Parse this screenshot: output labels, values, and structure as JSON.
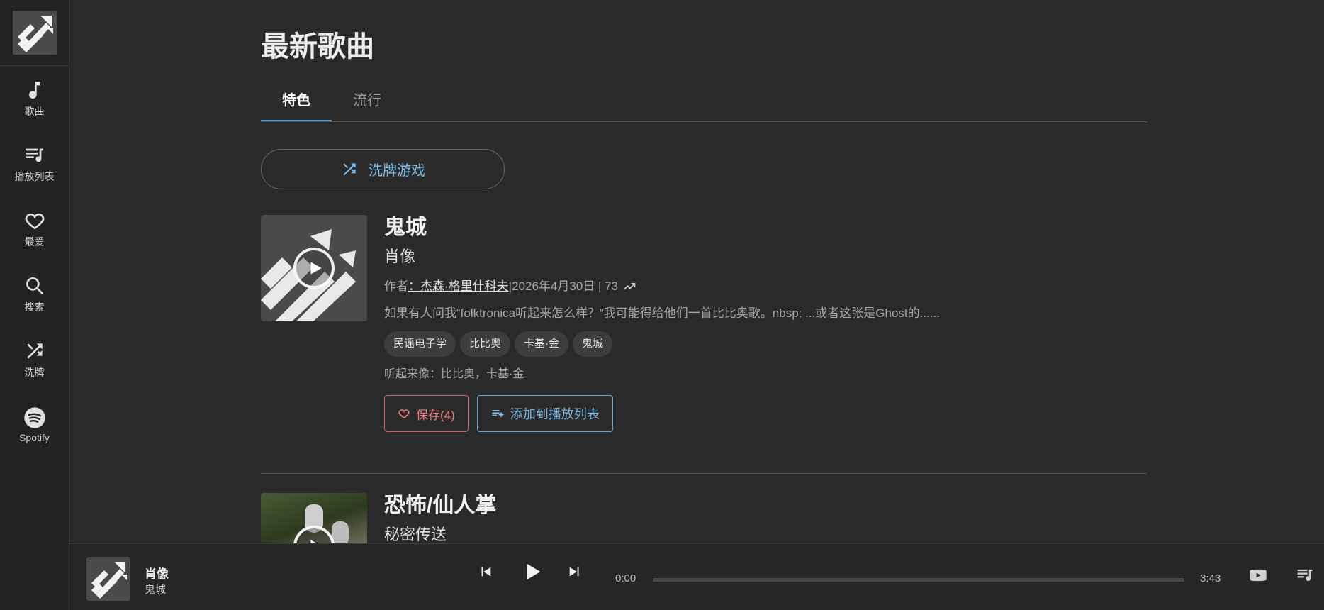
{
  "sidebar": {
    "items": [
      {
        "label": "歌曲",
        "icon": "music-note-icon"
      },
      {
        "label": "播放列表",
        "icon": "playlist-icon"
      },
      {
        "label": "最爱",
        "icon": "heart-icon"
      },
      {
        "label": "搜索",
        "icon": "search-icon"
      },
      {
        "label": "洗牌",
        "icon": "shuffle-icon"
      },
      {
        "label": "Spotify",
        "icon": "spotify-icon"
      }
    ]
  },
  "main": {
    "title": "最新歌曲",
    "tabs": [
      {
        "label": "特色",
        "active": true
      },
      {
        "label": "流行",
        "active": false
      }
    ],
    "shuffle_label": "洗牌游戏"
  },
  "songs": [
    {
      "title": "鬼城",
      "album": "肖像",
      "author_prefix": "作者",
      "author": "：杰森·格里什科夫",
      "meta_rest": " |2026年4月30日 | 73",
      "description": "如果有人问我“folktronica听起来怎么样？”我可能得给他们一首比比奥歌。nbsp; ...或者这张是Ghost的......",
      "tags": [
        "民谣电子学",
        "比比奥",
        "卡基·金",
        "鬼城"
      ],
      "sounds_like": "听起来像：比比奥，卡基·金",
      "save_label": "保存(4)",
      "add_label": "添加到播放列表"
    },
    {
      "title": "恐怖/仙人掌",
      "album": "秘密传送"
    }
  ],
  "player": {
    "title": "肖像",
    "album": "鬼城",
    "current_time": "0:00",
    "total_time": "3:43",
    "progress": 0
  },
  "colors": {
    "accent": "#7dbbe8",
    "save": "#ee7a7a",
    "background": "#2a2a2a",
    "sidebar": "#232323"
  }
}
